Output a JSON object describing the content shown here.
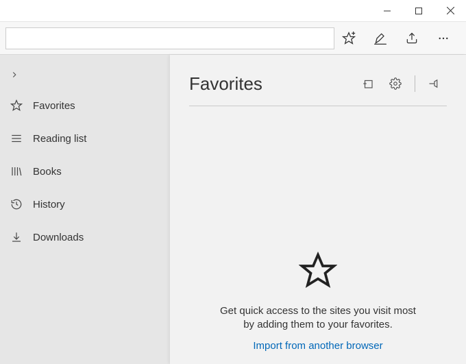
{
  "sidebar": {
    "items": [
      {
        "label": "Favorites"
      },
      {
        "label": "Reading list"
      },
      {
        "label": "Books"
      },
      {
        "label": "History"
      },
      {
        "label": "Downloads"
      }
    ]
  },
  "panel": {
    "title": "Favorites",
    "empty_message": "Get quick access to the sites you visit most by adding them to your favorites.",
    "import_link": "Import from another browser"
  },
  "colors": {
    "link": "#0067b8"
  }
}
